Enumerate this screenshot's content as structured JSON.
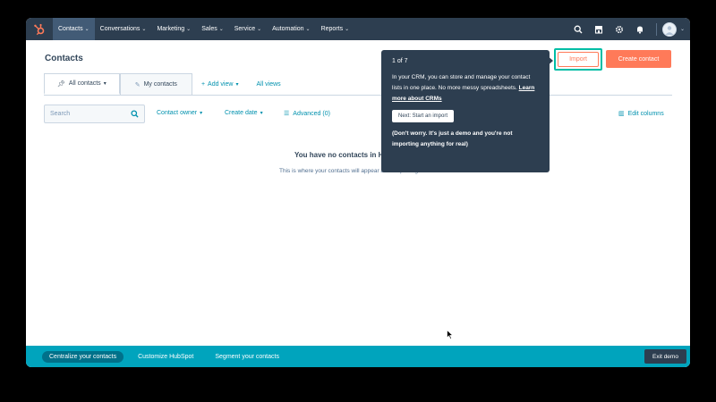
{
  "nav": {
    "items": [
      {
        "label": "Contacts",
        "active": true
      },
      {
        "label": "Conversations",
        "active": false
      },
      {
        "label": "Marketing",
        "active": false
      },
      {
        "label": "Sales",
        "active": false
      },
      {
        "label": "Service",
        "active": false
      },
      {
        "label": "Automation",
        "active": false
      },
      {
        "label": "Reports",
        "active": false
      }
    ],
    "icons": [
      "search-icon",
      "marketplace-icon",
      "settings-icon",
      "notifications-icon"
    ]
  },
  "header": {
    "title": "Contacts",
    "import_label": "Import",
    "create_label": "Create contact"
  },
  "tabs": {
    "all_contacts": "All contacts",
    "my_contacts": "My contacts",
    "add_view": "Add view",
    "all_views": "All views"
  },
  "filters": {
    "search_placeholder": "Search",
    "contact_owner": "Contact owner",
    "create_date": "Create date",
    "advanced": "Advanced (0)",
    "edit_columns": "Edit columns"
  },
  "empty_state": {
    "title": "You have no contacts in H",
    "subtitle": "This is where your contacts will appear after importing"
  },
  "popover": {
    "step": "1 of 7",
    "body": "In your CRM, you can store and manage your contact lists in one place. No more messy spreadsheets.",
    "link": "Learn more about CRMs",
    "button": "Next: Start an import",
    "note": "(Don't worry. It's just a demo and you're not importing anything for real)"
  },
  "demo_bar": {
    "steps": [
      "Centralize your contacts",
      "Customize HubSpot",
      "Segment your contacts"
    ],
    "exit_label": "Exit demo"
  },
  "colors": {
    "nav_bg": "#2d3e50",
    "accent_orange": "#ff7a59",
    "teal": "#00a4bd",
    "highlight": "#00bda5"
  }
}
